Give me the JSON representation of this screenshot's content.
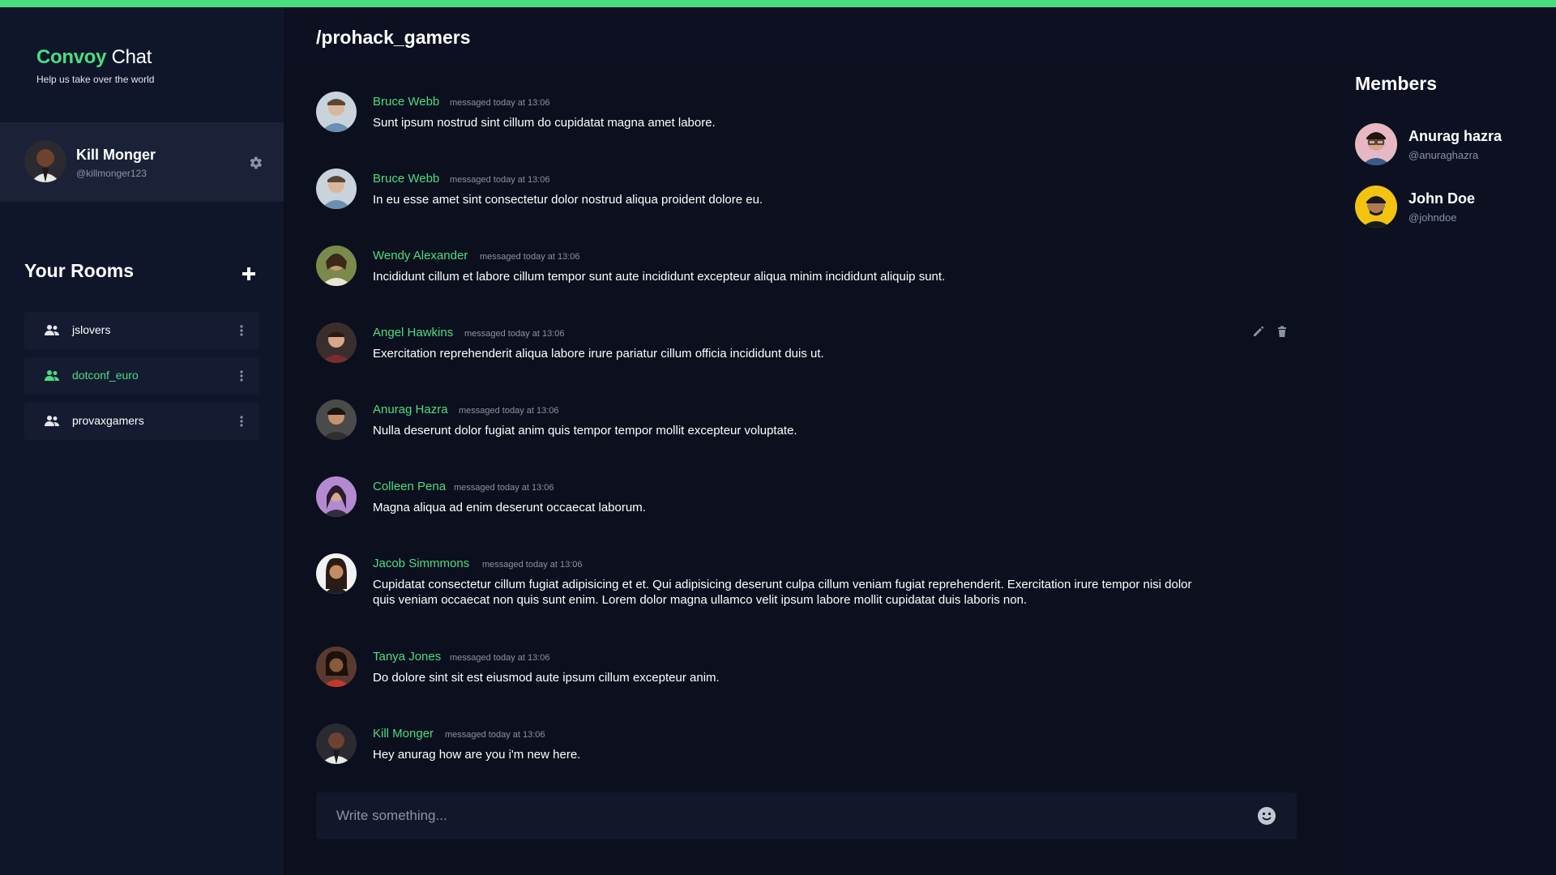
{
  "brand": {
    "name_accent": "Convoy",
    "name_rest": " Chat",
    "tagline": "Help us take over the world"
  },
  "colors": {
    "accent": "#4ade80",
    "background": "#0c1021",
    "sidebar": "#10162a",
    "card": "#1b2238",
    "muted": "#8b93a7"
  },
  "user": {
    "name": "Kill Monger",
    "handle": "@killmonger123",
    "settings_icon": "gear-icon"
  },
  "rooms": {
    "title": "Your Rooms",
    "add_icon": "plus-icon",
    "items": [
      {
        "label": "jslovers",
        "active": false
      },
      {
        "label": "dotconf_euro",
        "active": true
      },
      {
        "label": "provaxgamers",
        "active": false
      }
    ]
  },
  "channel": {
    "title": "/prohack_gamers"
  },
  "messages": [
    {
      "author": "Bruce Webb",
      "meta": "messaged today at 13:06",
      "text": "Sunt ipsum nostrud sint cillum do cupidatat magna amet labore."
    },
    {
      "author": "Bruce Webb",
      "meta": "messaged today at 13:06",
      "text": "In eu esse amet sint consectetur dolor nostrud aliqua proident dolore eu."
    },
    {
      "author": "Wendy Alexander",
      "meta": "messaged today at 13:06",
      "text": "Incididunt cillum et labore cillum tempor sunt aute incididunt excepteur aliqua minim incididunt aliquip sunt."
    },
    {
      "author": "Angel Hawkins",
      "meta": "messaged today at 13:06",
      "text": "Exercitation reprehenderit aliqua labore irure pariatur cillum officia incididunt duis ut."
    },
    {
      "author": "Anurag Hazra",
      "meta": "messaged today at 13:06",
      "text": "Nulla deserunt dolor fugiat anim quis tempor tempor mollit excepteur voluptate."
    },
    {
      "author": "Colleen Pena",
      "meta": "messaged today at 13:06",
      "text": "Magna aliqua ad enim deserunt occaecat laborum."
    },
    {
      "author": "Jacob Simmmons",
      "meta": "messaged today at 13:06",
      "text": "Cupidatat consectetur cillum fugiat adipisicing et et. Qui adipisicing deserunt culpa cillum veniam fugiat reprehenderit. Exercitation irure tempor nisi dolor quis veniam occaecat non quis sunt enim. Lorem dolor magna ullamco velit ipsum labore mollit cupidatat duis laboris non."
    },
    {
      "author": "Tanya Jones",
      "meta": "messaged today at 13:06",
      "text": "Do dolore sint sit est eiusmod aute ipsum cillum excepteur anim."
    },
    {
      "author": "Kill Monger",
      "meta": "messaged today at 13:06",
      "text": "Hey anurag how are you i'm new here."
    }
  ],
  "message_tools": {
    "edit_icon": "pencil-icon",
    "delete_icon": "trash-icon"
  },
  "composer": {
    "placeholder": "Write something...",
    "emoji_icon": "smiley-icon"
  },
  "members": {
    "title": "Members",
    "items": [
      {
        "name": "Anurag hazra",
        "handle": "@anuraghazra"
      },
      {
        "name": "John Doe",
        "handle": "@johndoe"
      }
    ]
  }
}
